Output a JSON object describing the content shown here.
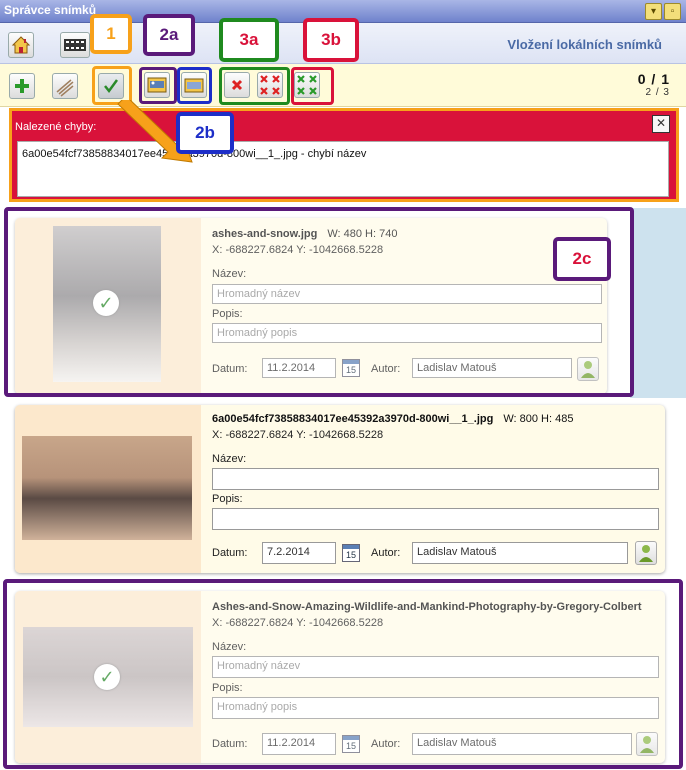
{
  "window": {
    "title": "Správce snímků",
    "minimize_icon": "chevron-down-icon",
    "maximize_icon": "maximize-icon"
  },
  "toolbar": {
    "heading": "Vložení lokálních snímků",
    "counter_main": "0 / 1",
    "counter_sub": "2 / 3"
  },
  "error": {
    "title": "Nalezené chyby:",
    "message": "6a00e54fcf73858834017ee45392a3970d-800wi__1_.jpg - chybí název",
    "close_symbol": "✕"
  },
  "labels": {
    "name": "Název:",
    "desc": "Popis:",
    "date": "Datum:",
    "author": "Autor:"
  },
  "placeholders": {
    "name": "Hromadný název",
    "desc": "Hromadný popis"
  },
  "images": [
    {
      "filename": "ashes-and-snow.jpg",
      "dims": "W: 480 H: 740",
      "coords": "X: -688227.6824   Y: -1042668.5228",
      "name": "",
      "desc": "",
      "date": "11.2.2014",
      "author": "Ladislav Matouš",
      "selected": true
    },
    {
      "filename": "6a00e54fcf73858834017ee45392a3970d-800wi__1_.jpg",
      "dims": "W: 800 H: 485",
      "coords": "X: -688227.6824   Y: -1042668.5228",
      "name": "",
      "desc": "",
      "date": "7.2.2014",
      "author": "Ladislav Matouš",
      "selected": false
    },
    {
      "filename": "Ashes-and-Snow-Amazing-Wildlife-and-Mankind-Photography-by-Gregory-Colbert",
      "dims": "",
      "coords": "X: -688227.6824   Y: -1042668.5228",
      "name": "",
      "desc": "",
      "date": "11.2.2014",
      "author": "Ladislav Matouš",
      "selected": true
    }
  ],
  "calendar_day": "15",
  "annotations": {
    "a1": "1",
    "a2a": "2a",
    "a2b": "2b",
    "a2c": "2c",
    "a3a": "3a",
    "a3b": "3b"
  },
  "colors": {
    "orange": "#f7a11a",
    "purple": "#5a1a7a",
    "blue": "#1d2ec8",
    "green": "#1f8a1f",
    "red": "#d9123a",
    "blue_badge": "#1d2ec8"
  }
}
